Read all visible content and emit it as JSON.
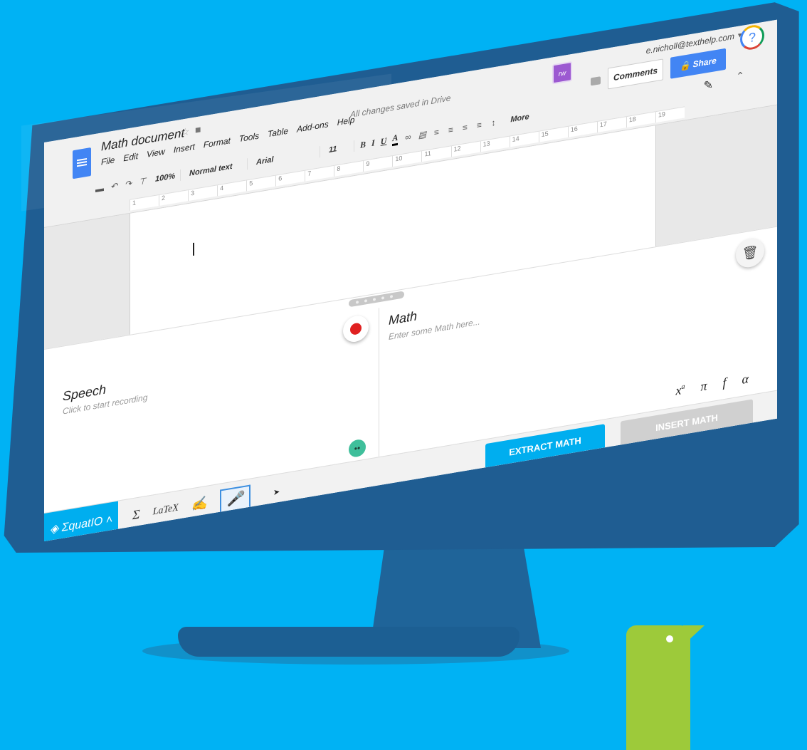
{
  "colors": {
    "background": "#00b2f4",
    "monitor_bezel": "#1f5d92",
    "docs_blue": "#4285f4",
    "equatio_blue": "#00aeef",
    "record_red": "#e02020",
    "mascot_green": "#9dca3a"
  },
  "docs": {
    "title": "Math document",
    "menu": [
      "File",
      "Edit",
      "View",
      "Insert",
      "Format",
      "Tools",
      "Table",
      "Add-ons",
      "Help"
    ],
    "saved_status": "All changes saved in Drive",
    "account_email": "e.nicholl@texthelp.com",
    "share_label": "Share",
    "comments_label": "Comments",
    "rw_badge": "rw",
    "help_label": "?",
    "toolbar": {
      "zoom": "100%",
      "style": "Normal text",
      "font": "Arial",
      "size": "11",
      "bold": "B",
      "italic": "I",
      "underline": "U",
      "text_color": "A",
      "more": "More"
    },
    "ruler_marks": [
      "1",
      "2",
      "3",
      "4",
      "5",
      "6",
      "7",
      "8",
      "9",
      "10",
      "11",
      "12",
      "13",
      "14",
      "15",
      "16",
      "17",
      "18",
      "19"
    ]
  },
  "equatio": {
    "speech_title": "Speech",
    "speech_hint": "Click to start recording",
    "math_title": "Math",
    "math_hint": "Enter some Math here...",
    "symbols": [
      "x",
      "a",
      "π",
      "f",
      "α"
    ],
    "brand": "ΣquatIO",
    "tools": [
      "Σ",
      "LaTeX"
    ],
    "extract_label": "EXTRACT MATH",
    "insert_label": "INSERT MATH"
  }
}
